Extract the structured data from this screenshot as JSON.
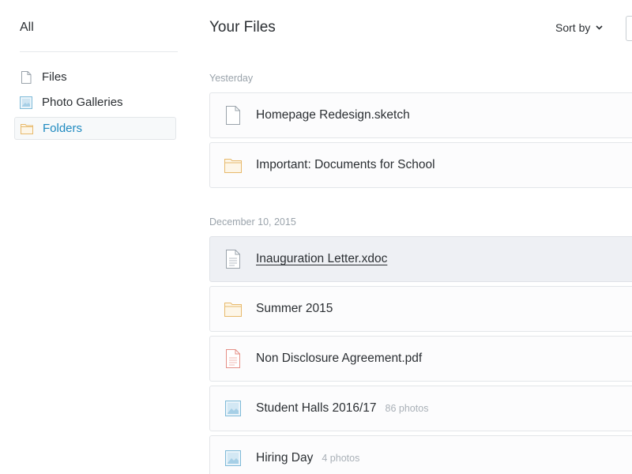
{
  "sidebar": {
    "all_label": "All",
    "items": [
      {
        "label": "Files",
        "icon": "file-icon"
      },
      {
        "label": "Photo Galleries",
        "icon": "image-icon"
      },
      {
        "label": "Folders",
        "icon": "folder-icon",
        "active": true
      }
    ]
  },
  "header": {
    "title": "Your Files",
    "sort_label": "Sort by"
  },
  "sections": [
    {
      "label": "Yesterday",
      "items": [
        {
          "name": "Homepage Redesign.sketch",
          "icon": "file-icon",
          "meta": ""
        },
        {
          "name": "Important: Documents for School",
          "icon": "folder-icon",
          "meta": ""
        }
      ]
    },
    {
      "label": "December 10, 2015",
      "items": [
        {
          "name": "Inauguration Letter.xdoc",
          "icon": "document-icon",
          "meta": "",
          "selected": true
        },
        {
          "name": "Summer 2015",
          "icon": "folder-icon",
          "meta": ""
        },
        {
          "name": "Non Disclosure Agreement.pdf",
          "icon": "pdf-icon",
          "meta": ""
        },
        {
          "name": "Student Halls 2016/17",
          "icon": "image-icon",
          "meta": "86 photos"
        },
        {
          "name": "Hiring Day",
          "icon": "image-icon",
          "meta": "4 photos"
        }
      ]
    }
  ],
  "colors": {
    "accent": "#1f8ac0",
    "folder": "#e7b96b",
    "pdf": "#e58f86",
    "image": "#7fbad8",
    "file": "#9aa3ab",
    "selected_row": "#eef0f4"
  }
}
